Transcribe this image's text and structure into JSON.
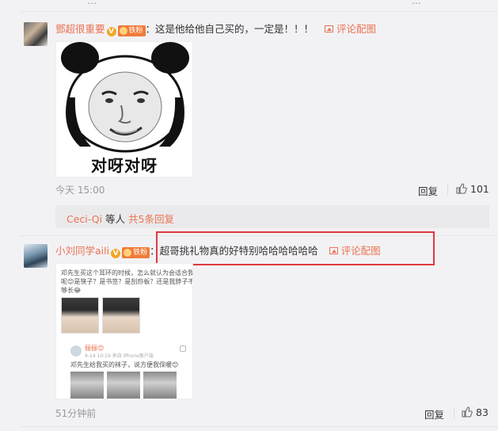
{
  "top_partial": {
    "left_text": "…",
    "right_text": "…"
  },
  "comments": [
    {
      "username": "鄧超很重要",
      "verified_mark": "V",
      "fan_badge": "铁粉",
      "text": "这是他给他自己买的，一定是！！！",
      "image_link": "评论配图",
      "image_caption": "对呀对呀",
      "time": "今天 15:00",
      "reply_label": "回复",
      "likes": "101"
    },
    {
      "username": "小刘同学aili",
      "verified_mark": "V",
      "fan_badge": "铁粉",
      "text": "超哥挑礼物真的好特别哈哈哈哈哈哈",
      "image_link": "评论配图",
      "time": "51分钟前",
      "reply_label": "回复",
      "likes": "83"
    }
  ],
  "reply_summary": {
    "name": "Ceci-Qi",
    "middle": " 等人 ",
    "more": "共5条回复"
  },
  "embedded_screenshot": {
    "line1": "邓先生买这个耳环的时候，怎么就认为会适合我",
    "line2": "呢😊是筷子？是书签？是刮痧板？还是我脖子不",
    "line3": "够长😂",
    "poster_name": "俪俪😊",
    "poster_sub": "9-14 10:19  来自 iPhone客户端",
    "body": "邓先生给我买的袜子，说方便我保暖😊"
  },
  "colors": {
    "accent": "#eb7350",
    "highlight_box": "#e0393e",
    "background": "#f2f2f5"
  }
}
